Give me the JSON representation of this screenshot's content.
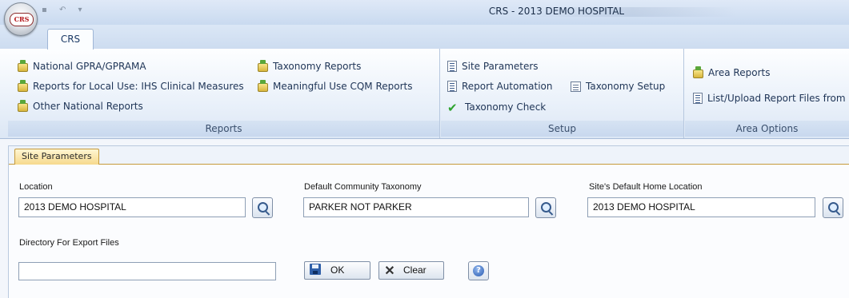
{
  "window": {
    "title": "CRS - 2013 DEMO HOSPITAL",
    "app_icon_text": "CRS"
  },
  "ribbon_tabs": [
    {
      "label": "CRS",
      "selected": true
    }
  ],
  "ribbon": {
    "groups": [
      {
        "label": "Reports",
        "items": [
          {
            "label": "National GPRA/GPRAMA",
            "icon": "report-folder-icon"
          },
          {
            "label": "Reports for Local Use: IHS Clinical Measures",
            "icon": "report-folder-icon"
          },
          {
            "label": "Other National Reports",
            "icon": "report-folder-icon"
          },
          {
            "label": "Taxonomy Reports",
            "icon": "report-folder-icon"
          },
          {
            "label": "Meaningful Use CQM Reports",
            "icon": "report-folder-icon"
          }
        ]
      },
      {
        "label": "Setup",
        "items": [
          {
            "label": "Site Parameters",
            "icon": "list-icon"
          },
          {
            "label": "Report Automation",
            "icon": "list-icon"
          },
          {
            "label": "Taxonomy Setup",
            "icon": "document-icon"
          },
          {
            "label": "Taxonomy Check",
            "icon": "checkmark-icon"
          }
        ]
      },
      {
        "label": "Area Options",
        "items": [
          {
            "label": "Area Reports",
            "icon": "report-folder-icon"
          },
          {
            "label": "List/Upload Report Files from",
            "icon": "list-icon"
          }
        ]
      }
    ]
  },
  "content_tab": {
    "label": "Site Parameters"
  },
  "form": {
    "location": {
      "label": "Location",
      "value": "2013 DEMO HOSPITAL"
    },
    "community_taxonomy": {
      "label": "Default Community Taxonomy",
      "value": "PARKER NOT PARKER"
    },
    "home_location": {
      "label": "Site's Default Home Location",
      "value": "2013 DEMO HOSPITAL"
    },
    "export_directory": {
      "label": "Directory For Export Files",
      "value": ""
    }
  },
  "buttons": {
    "ok": "OK",
    "clear": "Clear",
    "help": "?"
  },
  "colors": {
    "ribbon_bg": "#eaf1fa",
    "group_label_bg": "#c8d8ee",
    "content_tab_bg": "#f6d98d",
    "taxonomy_check_green": "#2ea32e"
  }
}
